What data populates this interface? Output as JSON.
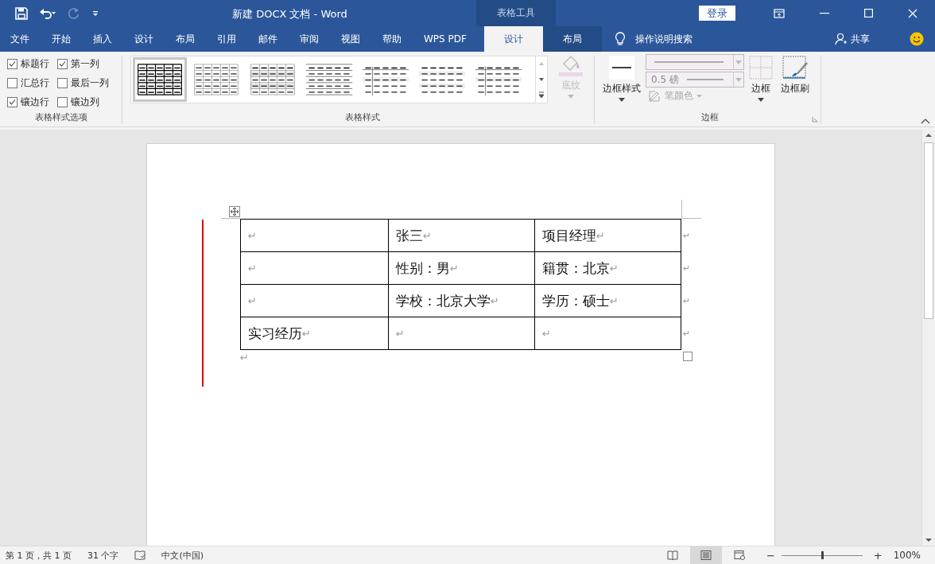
{
  "title_bar": {
    "title": "新建 DOCX 文档  -  Word",
    "context_label": "表格工具",
    "login": "登录",
    "redo_disabled": true
  },
  "menu_tabs": [
    {
      "label": "文件",
      "selected": false,
      "contextual": false
    },
    {
      "label": "开始",
      "selected": false,
      "contextual": false
    },
    {
      "label": "插入",
      "selected": false,
      "contextual": false
    },
    {
      "label": "设计",
      "selected": false,
      "contextual": false
    },
    {
      "label": "布局",
      "selected": false,
      "contextual": false
    },
    {
      "label": "引用",
      "selected": false,
      "contextual": false
    },
    {
      "label": "邮件",
      "selected": false,
      "contextual": false
    },
    {
      "label": "审阅",
      "selected": false,
      "contextual": false
    },
    {
      "label": "视图",
      "selected": false,
      "contextual": false
    },
    {
      "label": "帮助",
      "selected": false,
      "contextual": false
    },
    {
      "label": "WPS PDF",
      "selected": false,
      "contextual": false
    },
    {
      "label": "设计",
      "selected": true,
      "contextual": true
    },
    {
      "label": "布局",
      "selected": false,
      "contextual": true
    }
  ],
  "tell_me": "操作说明搜索",
  "share": "共享",
  "style_options": {
    "title": "表格样式选项",
    "options": [
      {
        "label": "标题行",
        "checked": true
      },
      {
        "label": "第一列",
        "checked": true
      },
      {
        "label": "汇总行",
        "checked": false
      },
      {
        "label": "最后一列",
        "checked": false
      },
      {
        "label": "镶边行",
        "checked": true
      },
      {
        "label": "镶边列",
        "checked": false
      }
    ]
  },
  "table_styles": {
    "title": "表格样式",
    "thumbnails": [
      {
        "kind": "grid-bold",
        "selected": true
      },
      {
        "kind": "grid-light",
        "selected": false
      },
      {
        "kind": "grid-banded",
        "selected": false
      },
      {
        "kind": "lines",
        "selected": false
      },
      {
        "kind": "header-column",
        "selected": false
      },
      {
        "kind": "banded",
        "selected": false
      },
      {
        "kind": "header-column",
        "selected": false
      }
    ],
    "shading": {
      "label": "底纹",
      "disabled": true
    }
  },
  "borders": {
    "title": "边框",
    "border_styles": "边框样式",
    "weight": "0.5 磅",
    "pen_color": "笔颜色",
    "borders": "边框",
    "border_painter": "边框刷"
  },
  "document": {
    "rows": [
      {
        "cells": [
          {
            "text": "",
            "mark": "↵"
          },
          {
            "text": "张三",
            "mark": "↵"
          },
          {
            "text": "项目经理",
            "mark": "↵"
          }
        ],
        "end_mark": "↵"
      },
      {
        "cells": [
          {
            "text": "",
            "mark": "↵"
          },
          {
            "text": "性别：男",
            "mark": "↵"
          },
          {
            "text": "籍贯：北京",
            "mark": "↵"
          }
        ],
        "end_mark": "↵"
      },
      {
        "cells": [
          {
            "text": "",
            "mark": "↵"
          },
          {
            "text": "学校：北京大学",
            "mark": "↵"
          },
          {
            "text": "学历：硕士",
            "mark": "↵"
          }
        ],
        "end_mark": "↵"
      },
      {
        "cells": [
          {
            "text": "实习经历",
            "mark": "↵"
          },
          {
            "text": "",
            "mark": "↵"
          },
          {
            "text": "",
            "mark": "↵"
          }
        ],
        "end_mark": "↵"
      }
    ],
    "after_mark": "↵"
  },
  "status_bar": {
    "page": "第 1 页，共 1 页",
    "words": "31 个字",
    "language": "中文(中国)",
    "views": [
      {
        "kind": "read",
        "selected": false
      },
      {
        "kind": "print",
        "selected": true
      },
      {
        "kind": "web",
        "selected": false
      }
    ],
    "zoom_out": "−",
    "zoom_slider": {
      "level": 0.5
    },
    "zoom_in": "+",
    "zoom": "100%"
  }
}
